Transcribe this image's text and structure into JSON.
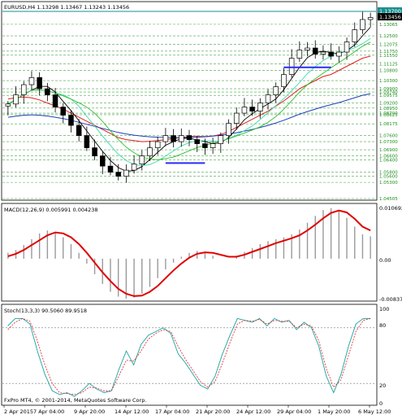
{
  "header": {
    "symbol_line": "EURUSD,H4  1.13298 1.13467 1.13243 1.13456",
    "macd_label": "MACD(12,26,9) 0.005991 0.004238",
    "stoch_label": "Stoch(13,3,3) 90.5060 89.9518",
    "copyright": "FxPro MT4, © 2001-2014, MetaQuotes Software Corp."
  },
  "price_axis": {
    "top_label": "1.13700",
    "current_label": "1.13456",
    "ticks": [
      "1.13065",
      "1.12500",
      "1.12075",
      "1.11750",
      "1.11550",
      "1.11125",
      "1.10800",
      "1.10300",
      "1.09900",
      "1.09740",
      "1.09575",
      "1.09200",
      "1.08950",
      "1.08700",
      "1.08625",
      "1.08175",
      "1.07600",
      "1.07300",
      "1.06900",
      "1.06600",
      "1.06400",
      "1.05800",
      "1.05600",
      "1.05300",
      "1.04505"
    ]
  },
  "macd_axis": {
    "top": "0.010692",
    "zero": "0.00",
    "bottom": "-0.008378"
  },
  "stoch_axis": {
    "top": "100",
    "hi": "80",
    "lo": "20",
    "bottom": "0"
  },
  "time_axis": [
    "2 Apr 2015",
    "7 Apr 04:00",
    "9 Apr 20:00",
    "14 Apr 12:00",
    "17 Apr 04:00",
    "21 Apr 20:00",
    "24 Apr 12:00",
    "29 Apr 04:00",
    "1 May 20:00",
    "6 May 12:00"
  ],
  "colors": {
    "candle": "#000000",
    "ma_red": "#e02020",
    "ma_blue": "#1e3fbf",
    "ma_green": "#2fbf2f",
    "ma_aqua": "#3fd9b0",
    "ma_black": "#000000",
    "hline": "#2a2aff",
    "macd_signal": "#e00000",
    "stoch_main": "#1aa3a3",
    "stoch_signal": "#e02020",
    "grid": "#1b8f1b"
  },
  "chart_data": [
    {
      "type": "line",
      "title": "EURUSD,H4",
      "ylim": [
        1.04505,
        1.137
      ],
      "series": [
        {
          "values": [
            1.0915,
            1.096,
            1.101,
            1.1045,
            1.099,
            1.096,
            1.09,
            1.086,
            1.081,
            1.076,
            1.07,
            1.066,
            1.061,
            1.058,
            1.056,
            1.059,
            1.062,
            1.066,
            1.07,
            1.073,
            1.076,
            1.073,
            1.076,
            1.074,
            1.072,
            1.07,
            1.072,
            1.076,
            1.082,
            1.087,
            1.09,
            1.088,
            1.092,
            1.096,
            1.1,
            1.106,
            1.114,
            1.118,
            1.119,
            1.116,
            1.117,
            1.115,
            1.117,
            1.122,
            1.128,
            1.133,
            1.134
          ]
        },
        {
          "values": [
            1.094,
            1.0945,
            1.095,
            1.0945,
            1.0935,
            1.092,
            1.0905,
            1.089,
            1.087,
            1.085,
            1.083,
            1.081,
            1.079,
            1.077,
            1.075,
            1.074,
            1.0735,
            1.073,
            1.0732,
            1.0735,
            1.074,
            1.0745,
            1.075,
            1.0755,
            1.0755,
            1.0755,
            1.0758,
            1.0765,
            1.078,
            1.08,
            1.082,
            1.084,
            1.086,
            1.088,
            1.0905,
            1.093,
            1.096,
            1.099,
            1.101,
            1.103,
            1.105,
            1.106,
            1.108,
            1.11,
            1.112,
            1.114,
            1.115
          ]
        },
        {
          "values": [
            1.085,
            1.0855,
            1.086,
            1.0862,
            1.086,
            1.0856,
            1.085,
            1.0843,
            1.0835,
            1.0825,
            1.0815,
            1.0805,
            1.0795,
            1.0785,
            1.0775,
            1.0768,
            1.0762,
            1.0757,
            1.0754,
            1.0752,
            1.0751,
            1.075,
            1.075,
            1.0751,
            1.0752,
            1.0754,
            1.0757,
            1.0761,
            1.0767,
            1.0774,
            1.0782,
            1.079,
            1.08,
            1.081,
            1.0822,
            1.0835,
            1.085,
            1.0865,
            1.0878,
            1.089,
            1.0902,
            1.0912,
            1.0922,
            1.0934,
            1.0946,
            1.0958,
            1.0966
          ]
        }
      ]
    },
    {
      "type": "bar",
      "title": "MACD(12,26,9)",
      "ylim": [
        -0.008378,
        0.010692
      ],
      "series": [
        {
          "values": [
            0.0012,
            0.0018,
            0.0028,
            0.004,
            0.0052,
            0.0058,
            0.0054,
            0.0044,
            0.003,
            0.0012,
            -0.001,
            -0.0032,
            -0.0052,
            -0.0068,
            -0.0078,
            -0.0082,
            -0.008,
            -0.0072,
            -0.0058,
            -0.004,
            -0.0022,
            -0.0008,
            0.0004,
            0.0012,
            0.0016,
            0.0014,
            0.0006,
            0.0,
            0.0,
            0.0006,
            0.0014,
            0.0022,
            0.003,
            0.0036,
            0.004,
            0.0044,
            0.005,
            0.006,
            0.0074,
            0.0088,
            0.01,
            0.0104,
            0.0098,
            0.0084,
            0.0066,
            0.005,
            0.0046
          ]
        },
        {
          "values": [
            0.0005,
            0.001,
            0.0018,
            0.0028,
            0.0038,
            0.0048,
            0.0054,
            0.0052,
            0.0044,
            0.003,
            0.0012,
            -0.0008,
            -0.0028,
            -0.0046,
            -0.0062,
            -0.0072,
            -0.0077,
            -0.0076,
            -0.0068,
            -0.0056,
            -0.004,
            -0.0024,
            -0.001,
            0.0002,
            0.001,
            0.0013,
            0.0012,
            0.0008,
            0.0004,
            0.0004,
            0.0008,
            0.0014,
            0.002,
            0.0026,
            0.0032,
            0.0037,
            0.0042,
            0.0048,
            0.0058,
            0.007,
            0.0083,
            0.0094,
            0.0099,
            0.0095,
            0.0082,
            0.0066,
            0.0058
          ]
        }
      ]
    },
    {
      "type": "line",
      "title": "Stoch(13,3,3)",
      "ylim": [
        0,
        100
      ],
      "series": [
        {
          "values": [
            82,
            90,
            90,
            84,
            55,
            30,
            12,
            8,
            10,
            6,
            12,
            20,
            14,
            10,
            12,
            35,
            55,
            40,
            62,
            72,
            76,
            80,
            74,
            52,
            42,
            30,
            18,
            14,
            28,
            52,
            72,
            90,
            88,
            86,
            90,
            82,
            90,
            86,
            88,
            78,
            86,
            80,
            60,
            28,
            10,
            30,
            60,
            84,
            90,
            90
          ]
        },
        {
          "values": [
            78,
            86,
            90,
            87,
            66,
            40,
            20,
            10,
            9,
            8,
            10,
            16,
            15,
            12,
            12,
            28,
            45,
            44,
            55,
            68,
            74,
            78,
            76,
            60,
            46,
            34,
            22,
            16,
            22,
            42,
            64,
            84,
            88,
            87,
            89,
            84,
            88,
            87,
            87,
            80,
            84,
            82,
            66,
            36,
            16,
            24,
            50,
            76,
            88,
            90
          ]
        }
      ]
    }
  ]
}
